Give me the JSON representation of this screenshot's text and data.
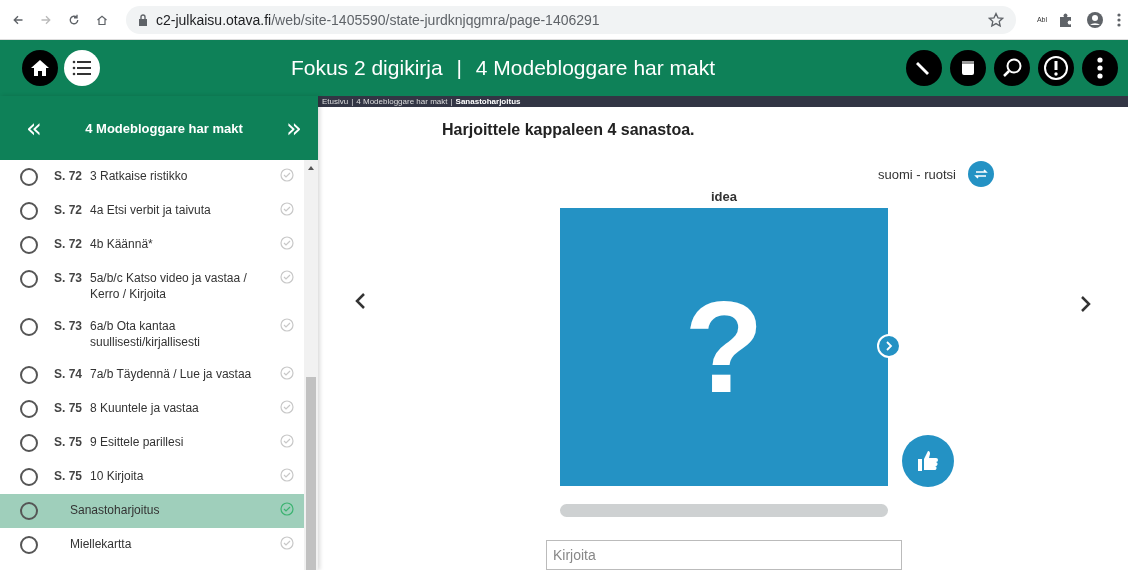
{
  "browser": {
    "url_domain": "c2-julkaisu.otava.fi",
    "url_path": "/web/site-1405590/state-jurdknjqgmra/page-1406291",
    "extension_label": "Abl"
  },
  "header": {
    "title": "Fokus 2 digikirja",
    "subtitle": "4 Modebloggare har makt",
    "separator": "|"
  },
  "sidebar": {
    "title": "4 Modebloggare har makt",
    "prev": "«",
    "next": "»",
    "items": [
      {
        "page": "S. 72",
        "title": "3 Ratkaise ristikko",
        "selected": false,
        "completed": false
      },
      {
        "page": "S. 72",
        "title": "4a Etsi verbit ja taivuta",
        "selected": false,
        "completed": false
      },
      {
        "page": "S. 72",
        "title": "4b Käännä*",
        "selected": false,
        "completed": false
      },
      {
        "page": "S. 73",
        "title": "5a/b/c Katso video ja vastaa / Kerro / Kirjoita",
        "selected": false,
        "completed": false
      },
      {
        "page": "S. 73",
        "title": "6a/b Ota kantaa suullisesti/kirjallisesti",
        "selected": false,
        "completed": false
      },
      {
        "page": "S. 74",
        "title": "7a/b Täydennä / Lue ja vastaa",
        "selected": false,
        "completed": false
      },
      {
        "page": "S. 75",
        "title": "8 Kuuntele ja vastaa",
        "selected": false,
        "completed": false
      },
      {
        "page": "S. 75",
        "title": "9 Esittele parillesi",
        "selected": false,
        "completed": false
      },
      {
        "page": "S. 75",
        "title": "10 Kirjoita",
        "selected": false,
        "completed": false
      },
      {
        "title": "Sanastoharjoitus",
        "selected": true,
        "completed": true
      },
      {
        "title": "Miellekartta",
        "selected": false,
        "completed": false
      }
    ]
  },
  "breadcrumb": {
    "separator": "|",
    "items": [
      {
        "label": "Etusivu",
        "current": false
      },
      {
        "label": "4 Modebloggare har makt",
        "current": false
      },
      {
        "label": "Sanastoharjoitus",
        "current": true
      }
    ]
  },
  "exercise": {
    "instruction": "Harjoittele kappaleen 4 sanastoa.",
    "language_pair": "suomi - ruotsi",
    "word": "idea",
    "card_symbol": "?",
    "progress": {
      "level": 0
    },
    "answer": {
      "placeholder": "Kirjoita"
    }
  }
}
